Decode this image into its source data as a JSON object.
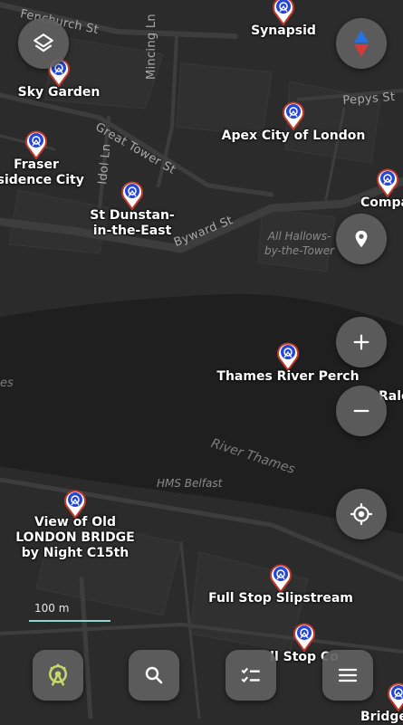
{
  "streets": {
    "fenchurch": "Fenchurch St",
    "mincing": "Mincing Ln",
    "great_tower": "Great Tower St",
    "idol": "Idol Ln",
    "byward": "Byward St",
    "pepys": "Pepys St",
    "river_name": "River Thames",
    "hms_belfast": "HMS Belfast",
    "all_hallows": "All Hallows-\nby-the-Tower",
    "edge_es": "es"
  },
  "pois": [
    {
      "name": "Synapsid"
    },
    {
      "name": "Sky Garden"
    },
    {
      "name": "Apex City of London"
    },
    {
      "name": "Fraser\nesidence City"
    },
    {
      "name": "St Dunstan-\nin-the-East"
    },
    {
      "name": "Compa"
    },
    {
      "name": "Thames River Perch"
    },
    {
      "name": "Rale"
    },
    {
      "name": "View of Old\nLONDON BRIDGE\nby Night C15th"
    },
    {
      "name": "Full Stop Slipstream"
    },
    {
      "name": "ll Stop Co"
    },
    {
      "name": "Bridge"
    }
  ],
  "scale": {
    "label": "100 m"
  },
  "colors": {
    "pin_ring": "#c0392b",
    "pin_inner": "#2346d6",
    "route_btn": "#c6d96b"
  },
  "icons": {
    "layers": "layers-icon",
    "compass": "compass-icon",
    "place": "place-icon",
    "zoom_in": "plus-icon",
    "zoom_out": "minus-icon",
    "locate": "my-location-icon",
    "route": "route-icon",
    "search": "search-icon",
    "checklist": "checklist-icon",
    "menu": "menu-icon"
  }
}
